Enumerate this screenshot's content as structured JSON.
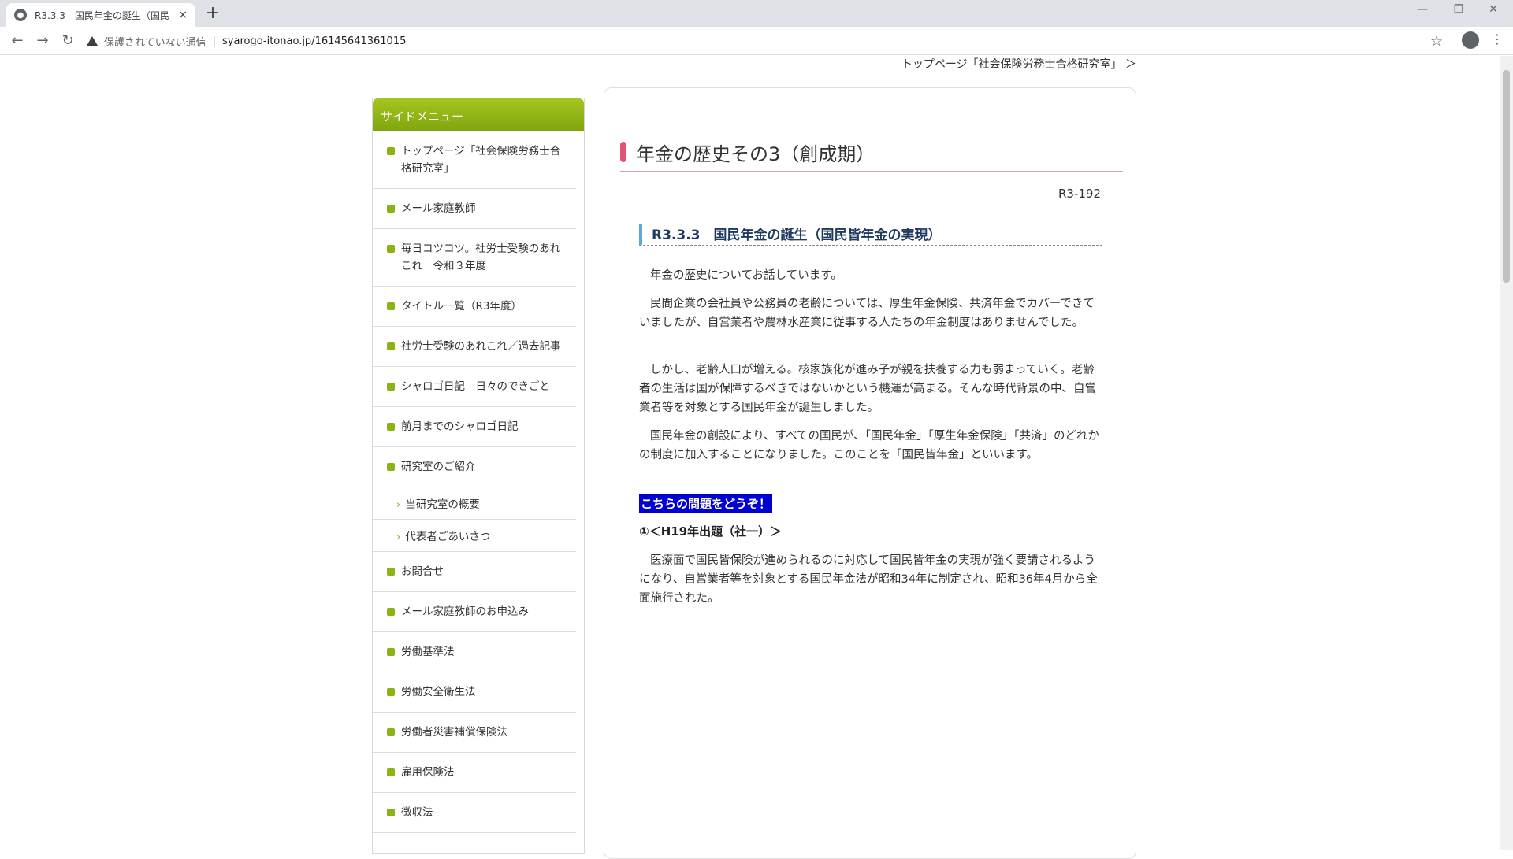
{
  "browser": {
    "tab_title": "R3.3.3　国民年金の誕生（国民皆",
    "tab_close": "×",
    "new_tab": "+",
    "security_label": "保護されていない通信",
    "url": "syarogo-itonao.jp/16145641361015",
    "window_controls": {
      "minimize": "—",
      "maximize": "❐",
      "close": "✕"
    }
  },
  "page": {
    "breadcrumb": "トップページ「社会保険労務士合格研究室」 ＞",
    "sidebar": {
      "header": "サイドメニュー",
      "items": [
        "トップページ「社会保険労務士合格研究室」",
        "メール家庭教師",
        "毎日コツコツ。社労士受験のあれこれ　令和３年度",
        "タイトル一覧（R3年度）",
        "社労士受験のあれこれ／過去記事",
        "シャロゴ日記　日々のできごと",
        "前月までのシャロゴ日記",
        "研究室のご紹介"
      ],
      "sub_items": [
        "当研究室の概要",
        "代表者ごあいさつ"
      ],
      "items2": [
        "お問合せ",
        "メール家庭教師のお申込み",
        "労働基準法",
        "労働安全衛生法",
        "労働者災害補償保険法",
        "雇用保険法",
        "徴収法"
      ]
    },
    "article": {
      "title": "年金の歴史その3（創成期）",
      "code": "R3-192",
      "section_title": "R3.3.3　国民年金の誕生（国民皆年金の実現）",
      "paragraphs": [
        "年金の歴史についてお話しています。",
        "民間企業の会社員や公務員の老齢については、厚生年金保険、共済年金でカバーできていましたが、自営業者や農林水産業に従事する人たちの年金制度はありませんでした。",
        "しかし、老齢人口が増える。核家族化が進み子が親を扶養する力も弱まっていく。老齢者の生活は国が保障するべきではないかという機運が高まる。そんな時代背景の中、自営業者等を対象とする国民年金が誕生しました。",
        "国民年金の創設により、すべての国民が、「国民年金」「厚生年金保険」「共済」のどれかの制度に加入することになりました。このことを「国民皆年金」といいます。"
      ],
      "highlight": "こちらの問題をどうぞ！",
      "question_title": "①＜H19年出題（社一）＞",
      "question_text": "医療面で国民皆保険が進められるのに対応して国民皆年金の実現が強く要請されるようになり、自営業者等を対象とする国民年金法が昭和34年に制定され、昭和36年4月から全面施行された。"
    }
  }
}
